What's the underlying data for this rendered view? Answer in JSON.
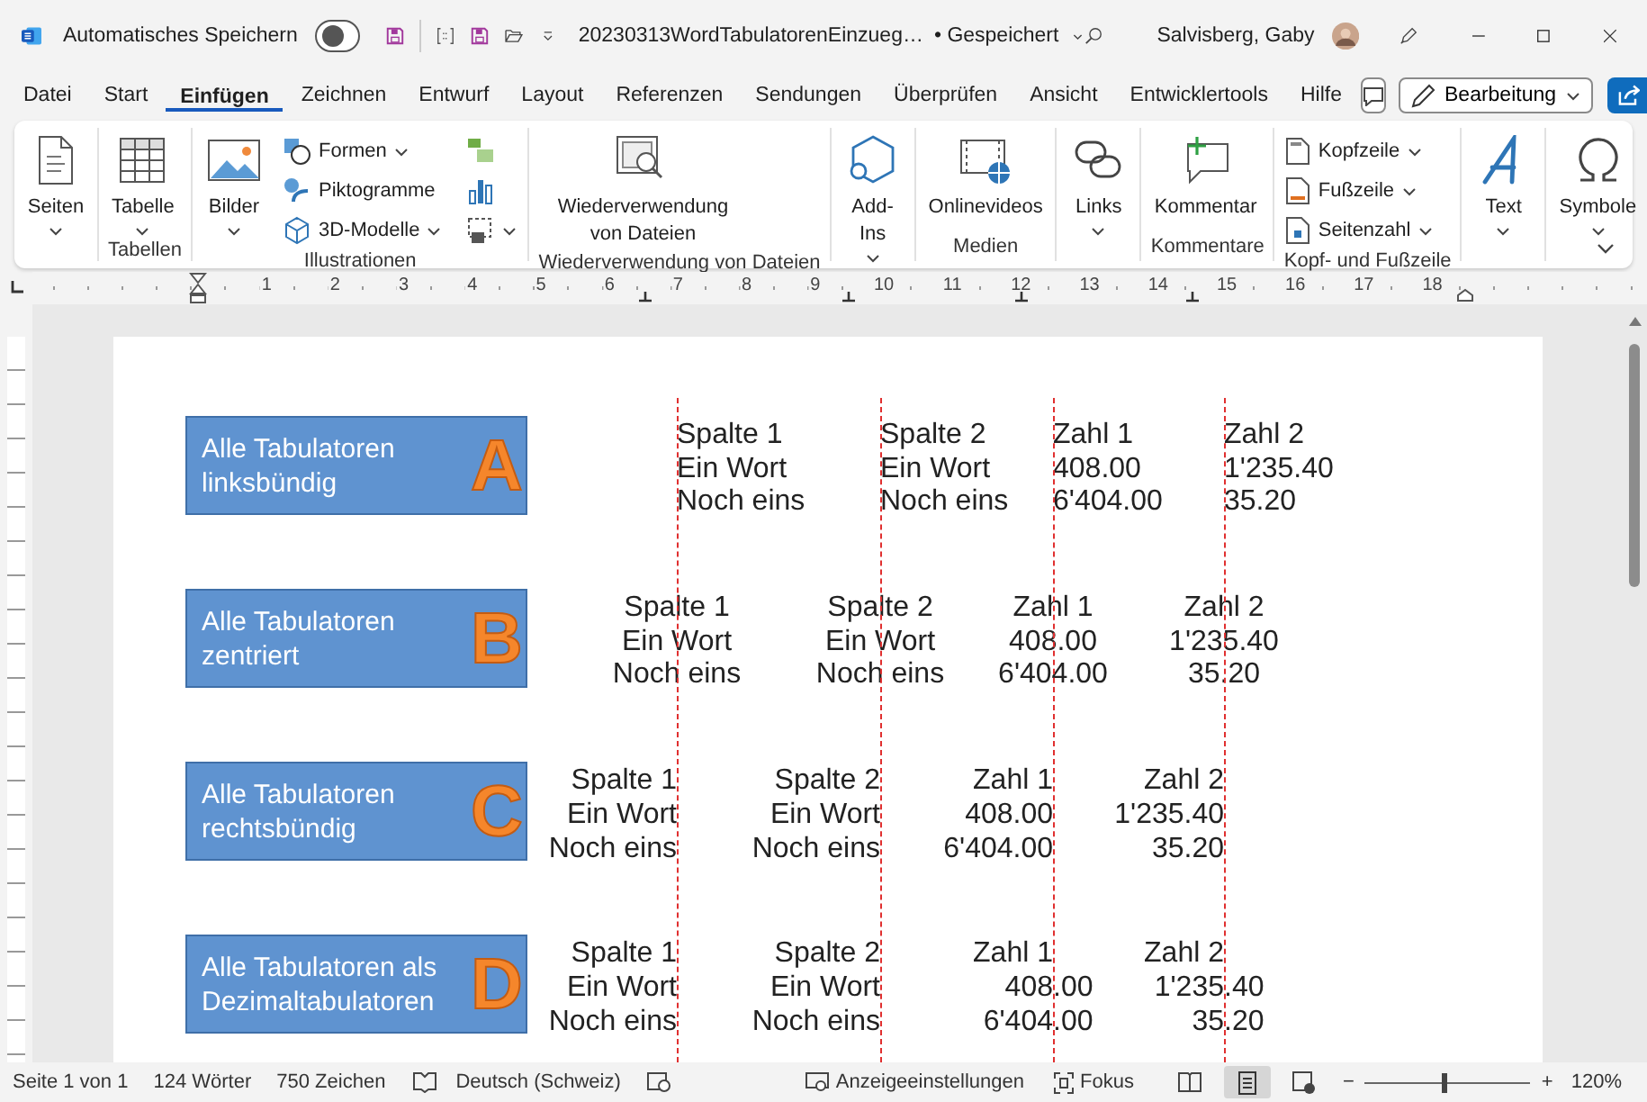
{
  "title_bar": {
    "autosave_label": "Automatisches Speichern",
    "autosave_on": false,
    "document_title": "20230313WordTabulatorenEinzueg…",
    "save_status": "• Gespeichert",
    "user_name": "Salvisberg, Gaby"
  },
  "menu_tabs": [
    {
      "label": "Datei",
      "selected": false
    },
    {
      "label": "Start",
      "selected": false
    },
    {
      "label": "Einfügen",
      "selected": true
    },
    {
      "label": "Zeichnen",
      "selected": false
    },
    {
      "label": "Entwurf",
      "selected": false
    },
    {
      "label": "Layout",
      "selected": false
    },
    {
      "label": "Referenzen",
      "selected": false
    },
    {
      "label": "Sendungen",
      "selected": false
    },
    {
      "label": "Überprüfen",
      "selected": false
    },
    {
      "label": "Ansicht",
      "selected": false
    },
    {
      "label": "Entwicklertools",
      "selected": false
    },
    {
      "label": "Hilfe",
      "selected": false
    }
  ],
  "menu_actions": {
    "mode_label": "Bearbeitung"
  },
  "ribbon": {
    "groups": [
      {
        "commands": [
          {
            "kind": "large",
            "label": "Seiten",
            "dropdown": true
          }
        ]
      },
      {
        "label": "Tabellen",
        "commands": [
          {
            "kind": "large",
            "label": "Tabelle",
            "dropdown": true
          }
        ]
      },
      {
        "label": "Illustrationen",
        "commands": [
          {
            "kind": "large",
            "label": "Bilder",
            "dropdown": true
          },
          {
            "kind": "small",
            "label": "Formen",
            "dropdown": true
          },
          {
            "kind": "small",
            "label": "Piktogramme",
            "dropdown": false
          },
          {
            "kind": "small",
            "label": "3D-Modelle",
            "dropdown": true
          },
          {
            "kind": "icon",
            "dropdown": false
          },
          {
            "kind": "icon",
            "dropdown": false
          },
          {
            "kind": "icon",
            "dropdown": true
          }
        ]
      },
      {
        "label": "Wiederverwendung von Dateien",
        "commands": [
          {
            "kind": "large",
            "label": "Wiederverwendung von Dateien",
            "dropdown": false
          }
        ]
      },
      {
        "commands": [
          {
            "kind": "large",
            "label": "Add-Ins",
            "dropdown": true
          }
        ]
      },
      {
        "label": "Medien",
        "commands": [
          {
            "kind": "large",
            "label": "Onlinevideos",
            "dropdown": false
          }
        ]
      },
      {
        "commands": [
          {
            "kind": "large",
            "label": "Links",
            "dropdown": true
          }
        ]
      },
      {
        "label": "Kommentare",
        "commands": [
          {
            "kind": "large",
            "label": "Kommentar",
            "dropdown": false
          }
        ]
      },
      {
        "label": "Kopf- und Fußzeile",
        "commands": [
          {
            "kind": "small",
            "label": "Kopfzeile",
            "dropdown": true
          },
          {
            "kind": "small",
            "label": "Fußzeile",
            "dropdown": true
          },
          {
            "kind": "small",
            "label": "Seitenzahl",
            "dropdown": true
          }
        ]
      },
      {
        "commands": [
          {
            "kind": "large",
            "label": "Text",
            "dropdown": true
          }
        ]
      },
      {
        "commands": [
          {
            "kind": "large",
            "label": "Symbole",
            "dropdown": true
          }
        ]
      }
    ]
  },
  "ruler": {
    "numbers": [
      "1",
      "2",
      "3",
      "4",
      "5",
      "6",
      "7",
      "8",
      "9",
      "10",
      "11",
      "12",
      "13",
      "14",
      "15",
      "16",
      "17",
      "18"
    ]
  },
  "document": {
    "blocks": [
      {
        "label": "Alle Tabulatoren linksbündig",
        "letter": "A",
        "kind": "left",
        "lines": [
          [
            "Spalte 1",
            "Spalte 2",
            "Zahl 1",
            "Zahl 2"
          ],
          [
            "Ein Wort",
            "Ein Wort",
            "408.00",
            "1'235.40"
          ],
          [
            "Noch eins",
            "Noch eins",
            "6'404.00",
            "35.20"
          ]
        ]
      },
      {
        "label": "Alle Tabulatoren zentriert",
        "letter": "B",
        "kind": "center",
        "lines": [
          [
            "Spalte 1",
            "Spalte 2",
            "Zahl 1",
            "Zahl 2"
          ],
          [
            "Ein Wort",
            "Ein Wort",
            "408.00",
            "1'235.40"
          ],
          [
            "Noch eins",
            "Noch eins",
            "6'404.00",
            "35.20"
          ]
        ]
      },
      {
        "label": "Alle Tabulatoren rechtsbündig",
        "letter": "C",
        "kind": "right",
        "lines": [
          [
            "Spalte 1",
            "Spalte 2",
            "Zahl 1",
            "Zahl 2"
          ],
          [
            "Ein Wort",
            "Ein Wort",
            "408.00",
            "1'235.40"
          ],
          [
            "Noch eins",
            "Noch eins",
            "6'404.00",
            "35.20"
          ]
        ]
      },
      {
        "label": "Alle Tabulatoren als Dezimaltabulatoren",
        "letter": "D",
        "kind": "decimal",
        "lines": [
          [
            "Spalte 1",
            "Spalte 2",
            "Zahl 1",
            "Zahl 2"
          ],
          [
            "Ein Wort",
            "Ein Wort",
            "408.00",
            "1'235.40"
          ],
          [
            "Noch eins",
            "Noch eins",
            "6'404.00",
            "35.20"
          ]
        ]
      }
    ]
  },
  "status_bar": {
    "page": "Seite 1 von 1",
    "words": "124 Wörter",
    "characters": "750 Zeichen",
    "language": "Deutsch (Schweiz)",
    "display_settings": "Anzeigeeinstellungen",
    "focus": "Fokus",
    "views": [
      {
        "kind": "read",
        "selected": false
      },
      {
        "kind": "print",
        "selected": true
      },
      {
        "kind": "web",
        "selected": false
      }
    ],
    "zoom_out": "−",
    "zoom_in": "+",
    "zoom": {
      "level": 0.48
    },
    "zoom_reading": "120%"
  }
}
